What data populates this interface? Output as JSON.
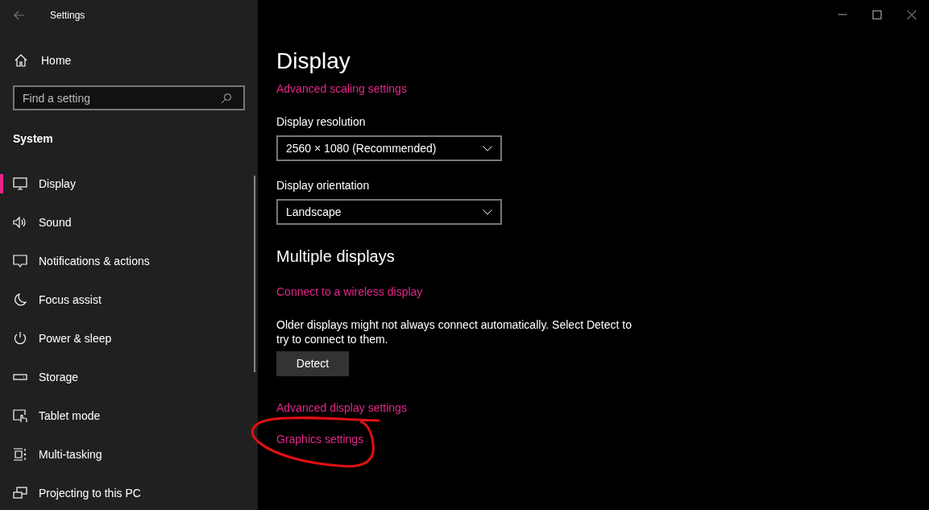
{
  "window": {
    "title": "Settings"
  },
  "sidebar": {
    "home": "Home",
    "search": {
      "placeholder": "Find a setting"
    },
    "section": "System",
    "items": [
      {
        "label": "Display",
        "selected": true
      },
      {
        "label": "Sound",
        "selected": false
      },
      {
        "label": "Notifications & actions",
        "selected": false
      },
      {
        "label": "Focus assist",
        "selected": false
      },
      {
        "label": "Power & sleep",
        "selected": false
      },
      {
        "label": "Storage",
        "selected": false
      },
      {
        "label": "Tablet mode",
        "selected": false
      },
      {
        "label": "Multi-tasking",
        "selected": false
      },
      {
        "label": "Projecting to this PC",
        "selected": false
      }
    ]
  },
  "content": {
    "title": "Display",
    "scaling_link": "Advanced scaling settings",
    "fields": [
      {
        "label": "Display resolution",
        "value": "2560 × 1080 (Recommended)"
      },
      {
        "label": "Display orientation",
        "value": "Landscape"
      }
    ],
    "multiple_heading": "Multiple displays",
    "wireless_link": "Connect to a wireless display",
    "description": "Older displays might not always connect automatically. Select Detect to try to connect to them.",
    "detect_button": "Detect",
    "links": [
      "Advanced display settings",
      "Graphics settings"
    ]
  }
}
